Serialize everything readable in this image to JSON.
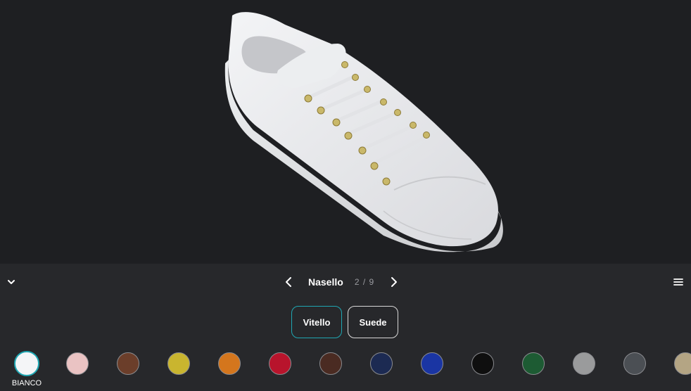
{
  "viewer": {
    "product": "white-leather-sneaker",
    "background": "#1e1f22"
  },
  "toolbar": {
    "collapse_icon": "chevron-down-icon",
    "menu_icon": "hamburger-menu-icon",
    "prev_icon": "chevron-left-icon",
    "next_icon": "chevron-right-icon",
    "section_title": "Nasello",
    "section_count": "2 / 9"
  },
  "materials": [
    {
      "label": "Vitello",
      "active": true
    },
    {
      "label": "Suede",
      "active": false
    }
  ],
  "swatches": {
    "selected_label": "BIANCO",
    "colors": [
      "#f4f5f7",
      "#eac3c3",
      "#6b3e2a",
      "#c9b52f",
      "#d4761d",
      "#b8142c",
      "#4a2b22",
      "#1c2a52",
      "#1a35a3",
      "#0f0f0f",
      "#1d5b33",
      "#9a9b9c",
      "#4b4f54",
      "#b4a584"
    ]
  },
  "accent_color": "#1fa7b3"
}
